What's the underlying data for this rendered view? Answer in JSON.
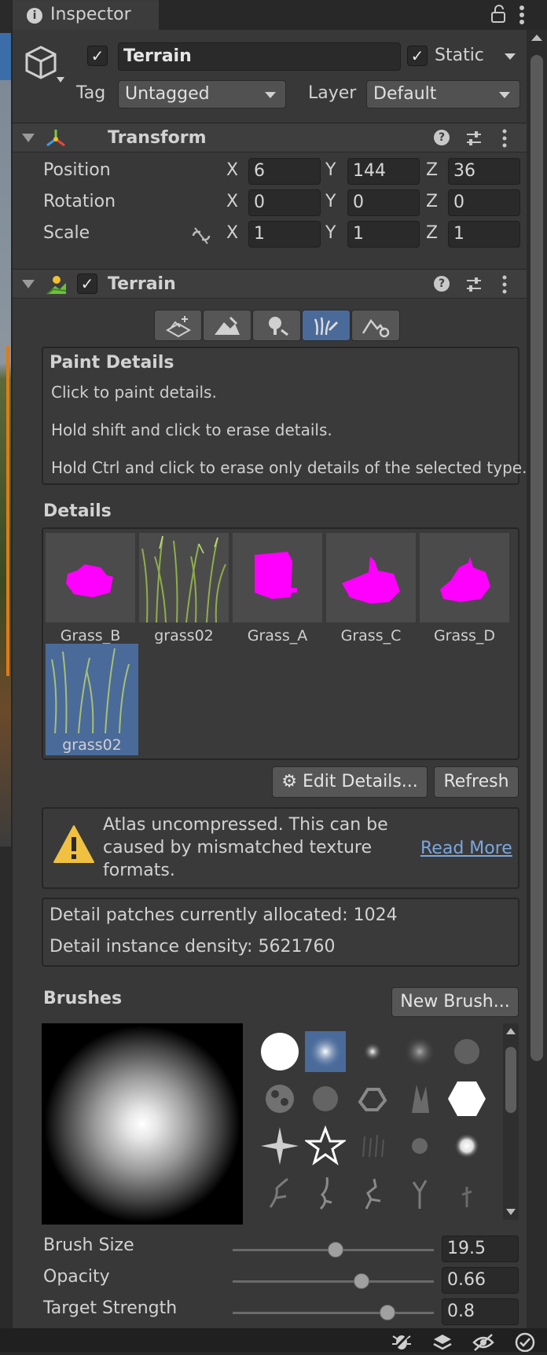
{
  "tab": {
    "title": "Inspector"
  },
  "object": {
    "name": "Terrain",
    "active": true,
    "static_label": "Static",
    "static": true,
    "tag_label": "Tag",
    "tag_value": "Untagged",
    "layer_label": "Layer",
    "layer_value": "Default"
  },
  "transform": {
    "title": "Transform",
    "rows": [
      {
        "label": "Position",
        "x": "6",
        "y": "144",
        "z": "36"
      },
      {
        "label": "Rotation",
        "x": "0",
        "y": "0",
        "z": "0"
      },
      {
        "label": "Scale",
        "x": "1",
        "y": "1",
        "z": "1"
      }
    ],
    "axis": {
      "x": "X",
      "y": "Y",
      "z": "Z"
    }
  },
  "terrain": {
    "title": "Terrain",
    "enabled": true,
    "tools": [
      "create-neighbor-icon",
      "paint-terrain-icon",
      "paint-trees-icon",
      "paint-details-icon",
      "terrain-settings-icon"
    ],
    "active_tool": 3
  },
  "paint_details": {
    "title": "Paint Details",
    "lines": [
      "Click to paint details.",
      "Hold shift and click to erase details.",
      "Hold Ctrl and click to erase only details of the selected type."
    ]
  },
  "details": {
    "label": "Details",
    "items": [
      {
        "name": "Grass_B",
        "kind": "missing"
      },
      {
        "name": "grass02",
        "kind": "grass"
      },
      {
        "name": "Grass_A",
        "kind": "missing"
      },
      {
        "name": "Grass_C",
        "kind": "missing"
      },
      {
        "name": "Grass_D",
        "kind": "missing"
      },
      {
        "name": "grass02",
        "kind": "grass",
        "selected": true
      }
    ],
    "edit_button": "Edit Details...",
    "refresh_button": "Refresh"
  },
  "warning": {
    "text": "Atlas uncompressed. This can be caused by mismatched texture formats.",
    "line1": "Atlas uncompressed. This can be",
    "line2": "caused by mismatched texture",
    "line3": "formats.",
    "link": "Read More"
  },
  "stats": {
    "patches": "Detail patches currently allocated: 1024",
    "density": "Detail instance density: 5621760"
  },
  "brushes": {
    "label": "Brushes",
    "new_button": "New Brush...",
    "selected_index": 1
  },
  "settings": [
    {
      "label": "Brush Size",
      "value": "19.5",
      "fraction": 0.51
    },
    {
      "label": "Opacity",
      "value": "0.66",
      "fraction": 0.64
    },
    {
      "label": "Target Strength",
      "value": "0.8",
      "fraction": 0.77
    }
  ],
  "colors": {
    "accent": "#4a6a9a",
    "missing_texture": "#ff00ff",
    "warning": "#f0c040",
    "link": "#7aa7e0"
  }
}
